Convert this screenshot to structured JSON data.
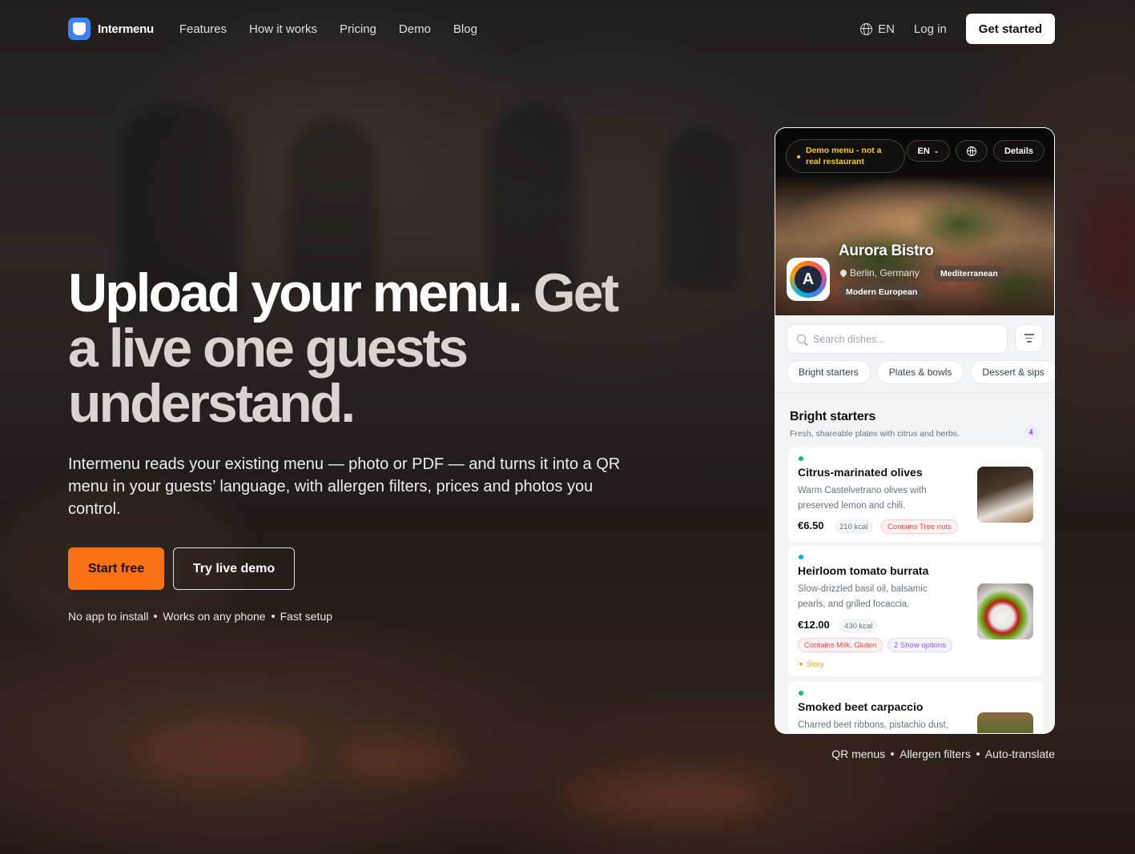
{
  "brand": {
    "name": "Intermenu"
  },
  "nav": {
    "links": [
      "Features",
      "How it works",
      "Pricing",
      "Demo",
      "Blog"
    ],
    "language": "EN",
    "login": "Log in",
    "cta": "Get started"
  },
  "hero": {
    "title_part1": "Upload your menu.",
    "title_part2": "Get a live one guests understand.",
    "subtitle": "Intermenu reads your existing menu — photo or PDF — and turns it into a QR menu in your guests’ language, with allergen filters, prices and photos you control.",
    "primary_cta": "Start free",
    "secondary_cta": "Try live demo",
    "taglines": [
      "No app to install",
      "Works on any phone",
      "Fast setup"
    ]
  },
  "demo_phone": {
    "demo_notice": "Demo menu - not a real restaurant",
    "language": "EN",
    "details": "Details",
    "restaurant": {
      "name": "Aurora Bistro",
      "logo_letter": "A",
      "location": "Berlin, Germany",
      "tags": [
        "Mediterranean",
        "Modern European"
      ]
    },
    "search_placeholder": "Search dishes...",
    "categories": [
      "Bright starters",
      "Plates & bowls",
      "Dessert & sips"
    ],
    "section": {
      "title": "Bright starters",
      "subtitle": "Fresh, shareable plates with citrus and herbs.",
      "count": "4"
    },
    "dishes": [
      {
        "name": "Citrus-marinated olives",
        "description": "Warm Castelvetrano olives with preserved lemon and chili.",
        "price": "€6.50",
        "kcal": "210 kcal",
        "allergens": "Contains Tree nuts",
        "indicator_color": "#10b981"
      },
      {
        "name": "Heirloom tomato burrata",
        "description": "Slow-drizzled basil oil, balsamic pearls, and grilled focaccia.",
        "price": "€12.00",
        "kcal": "430 kcal",
        "allergens": "Contains Milk, Gluten",
        "options": "2 Show options",
        "story": "✦ Story",
        "indicator_color": "#0ea5e9"
      },
      {
        "name": "Smoked beet carpaccio",
        "description": "Charred beet ribbons, pistachio dust,",
        "indicator_color": "#10b981"
      }
    ]
  },
  "feature_tags": [
    "QR menus",
    "Allergen filters",
    "Auto-translate"
  ],
  "colors": {
    "accent": "#f97316",
    "brand": "#3b82f6"
  }
}
